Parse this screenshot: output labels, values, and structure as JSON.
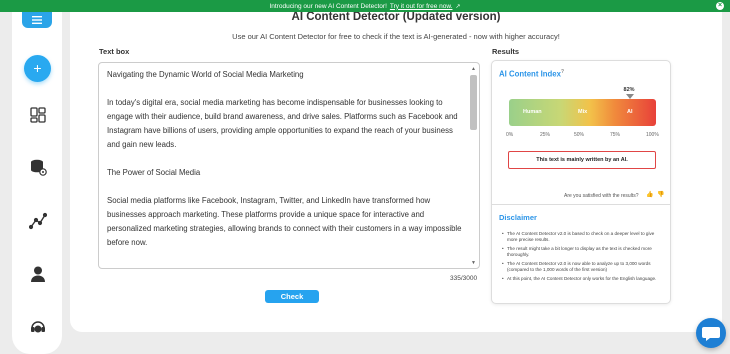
{
  "banner": {
    "text": "Introducing our new AI Content Detector!",
    "link": "Try it out for free now.",
    "close_glyph": "×"
  },
  "sidebar": {
    "plus_glyph": "+",
    "icons": [
      "menu-icon",
      "add-icon",
      "dashboard-grid-icon",
      "database-settings-icon",
      "analytics-chart-icon",
      "user-icon",
      "support-headset-icon"
    ]
  },
  "header": {
    "title": "AI Content Detector (Updated version)",
    "subtitle": "Use our AI Content Detector for free to check if the text is AI-generated - now with higher accuracy!"
  },
  "textbox": {
    "label": "Text box",
    "paragraphs": [
      "Navigating the Dynamic World of Social Media Marketing",
      "In today's digital era, social media marketing has become indispensable for businesses looking to engage with their audience, build brand awareness, and drive sales. Platforms such as Facebook and Instagram have billions of users, providing ample opportunities to expand the reach of your business and gain new leads.",
      "The Power of Social Media",
      "Social media platforms like Facebook, Instagram, Twitter, and LinkedIn have transformed how businesses approach marketing. These platforms provide a unique space for interactive and personalized marketing strategies, allowing brands to connect with their customers in a way impossible before now."
    ],
    "counter": "335/3000",
    "check_label": "Check"
  },
  "results": {
    "label": "Results",
    "index_title": "AI Content Index",
    "info_glyph": "?",
    "score_text": "82%",
    "score_value": 0.82,
    "gauge_labels": [
      "Human",
      "Mix",
      "AI"
    ],
    "ticks": [
      "0%",
      "25%",
      "50%",
      "75%",
      "100%"
    ],
    "verdict": "This text is mainly written by an AI.",
    "satisfied": "Are you satisfied with the results?",
    "thumbs_up": "👍",
    "thumbs_down": "👎",
    "colors": {
      "accent": "#2c95e8",
      "verdict_border": "#e04545"
    }
  },
  "disclaimer": {
    "title": "Disclaimer",
    "items": [
      "The AI Content Detector v2.0 is based to check on a deeper level to give more precise results.",
      "The result might take a bit longer to display as the text is checked more thoroughly.",
      "The AI Content Detector v2.0 is now able to analyze up to 3,000 words (compared to the 1,000 words of the first version)",
      "At this point, the AI Content Detector only works for the English language."
    ]
  }
}
